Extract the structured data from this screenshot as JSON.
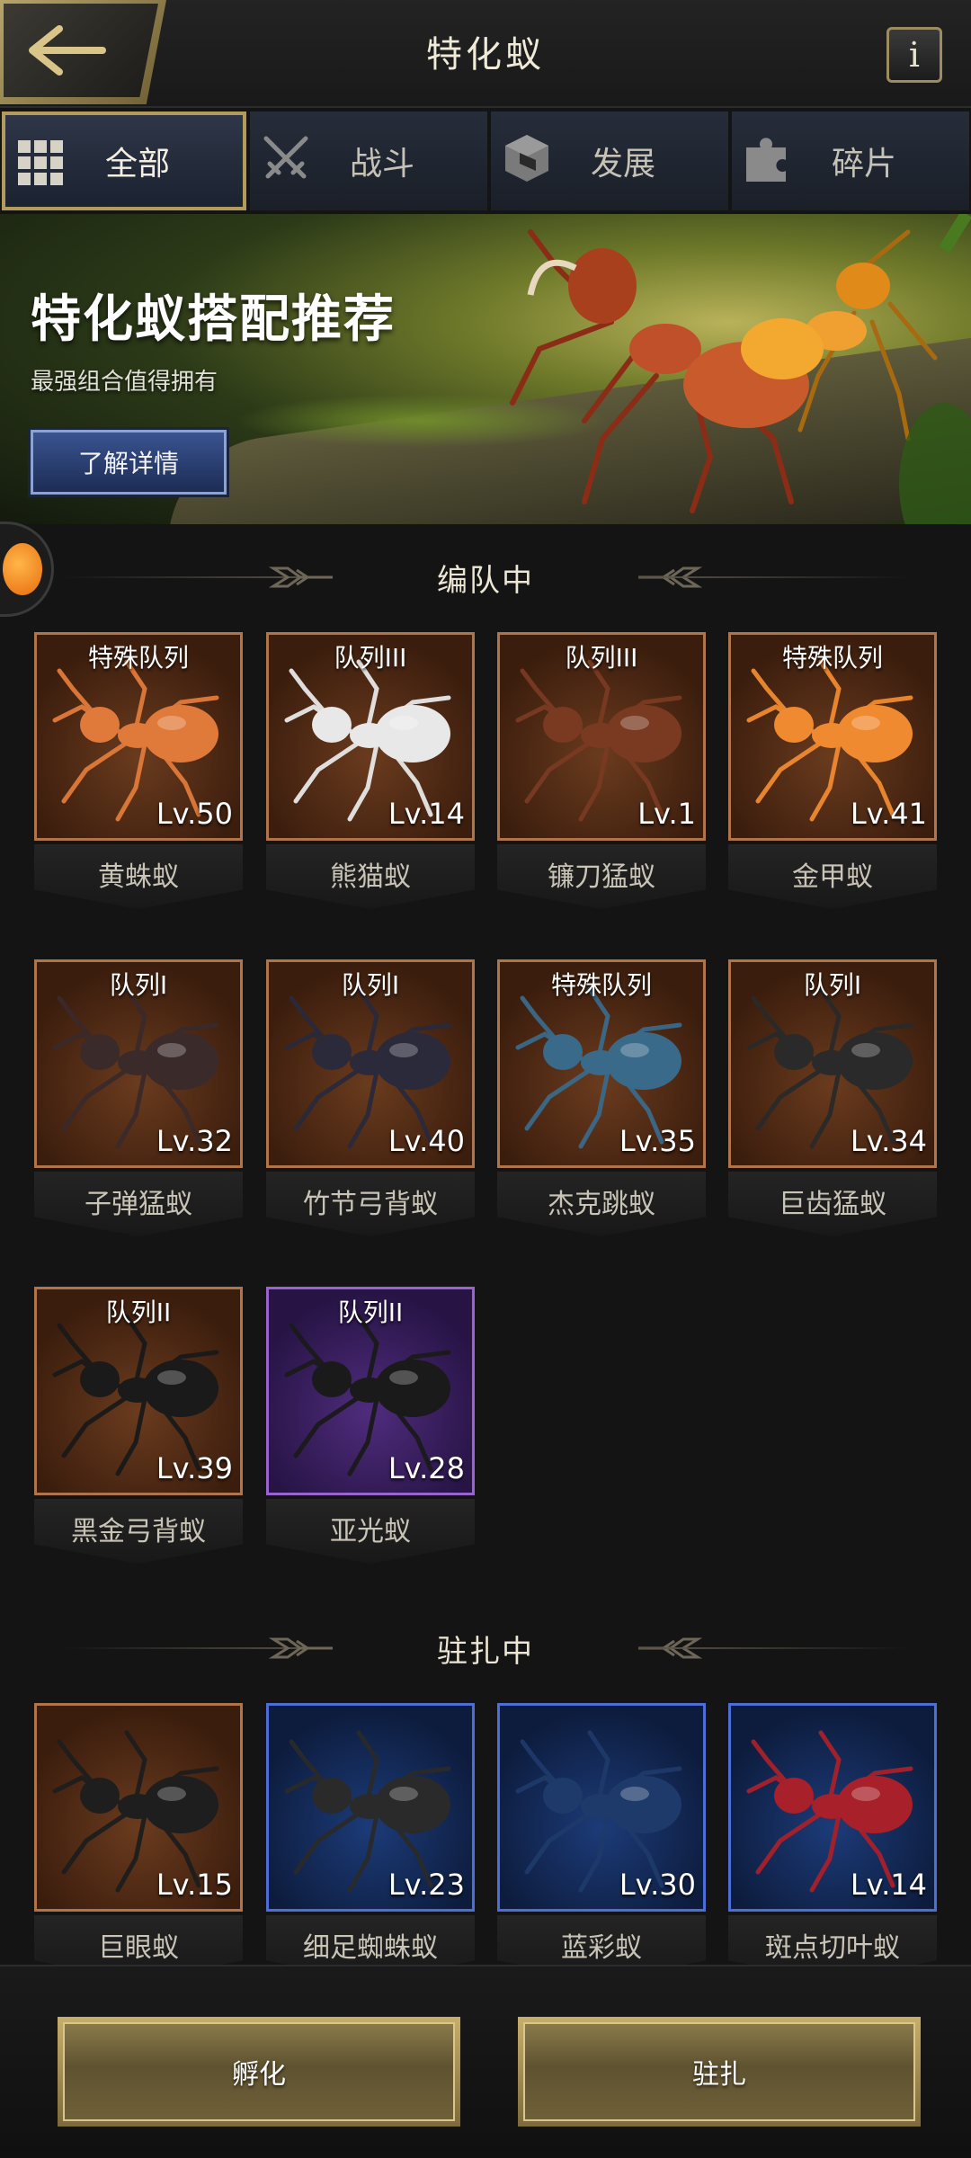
{
  "header": {
    "title": "特化蚁",
    "info_label": "i"
  },
  "tabs": [
    {
      "label": "全部",
      "icon": "grid-icon",
      "active": true
    },
    {
      "label": "战斗",
      "icon": "crossed-swords-icon",
      "active": false
    },
    {
      "label": "发展",
      "icon": "cube-icon",
      "active": false
    },
    {
      "label": "碎片",
      "icon": "puzzle-icon",
      "active": false
    }
  ],
  "banner": {
    "title": "特化蚁搭配推荐",
    "subtitle": "最强组合值得拥有",
    "button_label": "了解详情"
  },
  "sections": {
    "in_formation": "编队中",
    "stationed": "驻扎中"
  },
  "formation_ants": [
    {
      "tag": "特殊队列",
      "level": "Lv.50",
      "name": "黄蛛蚁",
      "rarity": "orange",
      "ant_color": "#e07a3a"
    },
    {
      "tag": "队列III",
      "level": "Lv.14",
      "name": "熊猫蚁",
      "rarity": "orange",
      "ant_color": "#e8e8e8"
    },
    {
      "tag": "队列III",
      "level": "Lv.1",
      "name": "镰刀猛蚁",
      "rarity": "orange",
      "ant_color": "#7a3a22"
    },
    {
      "tag": "特殊队列",
      "level": "Lv.41",
      "name": "金甲蚁",
      "rarity": "orange",
      "ant_color": "#f08a30"
    },
    {
      "tag": "队列I",
      "level": "Lv.32",
      "name": "子弹猛蚁",
      "rarity": "orange",
      "ant_color": "#3a2a2a"
    },
    {
      "tag": "队列I",
      "level": "Lv.40",
      "name": "竹节弓背蚁",
      "rarity": "orange",
      "ant_color": "#2a2a3a"
    },
    {
      "tag": "特殊队列",
      "level": "Lv.35",
      "name": "杰克跳蚁",
      "rarity": "orange",
      "ant_color": "#3a6a8a"
    },
    {
      "tag": "队列I",
      "level": "Lv.34",
      "name": "巨齿猛蚁",
      "rarity": "orange",
      "ant_color": "#2a2a2a"
    },
    {
      "tag": "队列II",
      "level": "Lv.39",
      "name": "黑金弓背蚁",
      "rarity": "orange",
      "ant_color": "#1a1a1a"
    },
    {
      "tag": "队列II",
      "level": "Lv.28",
      "name": "亚光蚁",
      "rarity": "purple",
      "ant_color": "#1a1a1a"
    }
  ],
  "stationed_ants": [
    {
      "tag": "",
      "level": "Lv.15",
      "name": "巨眼蚁",
      "rarity": "orange",
      "ant_color": "#1e1e1e"
    },
    {
      "tag": "",
      "level": "Lv.23",
      "name": "细足蜘蛛蚁",
      "rarity": "blue",
      "ant_color": "#2a2a2a"
    },
    {
      "tag": "",
      "level": "Lv.30",
      "name": "蓝彩蚁",
      "rarity": "blue",
      "ant_color": "#1e3a6a"
    },
    {
      "tag": "",
      "level": "Lv.14",
      "name": "斑点切叶蚁",
      "rarity": "blue",
      "ant_color": "#a8202a"
    }
  ],
  "actions": {
    "hatch_label": "孵化",
    "station_label": "驻扎"
  },
  "colors": {
    "accent_gold": "#b39b5c",
    "rarity_orange": "#b0744a",
    "rarity_purple": "#9a64d0",
    "rarity_blue": "#4c6ed6"
  }
}
